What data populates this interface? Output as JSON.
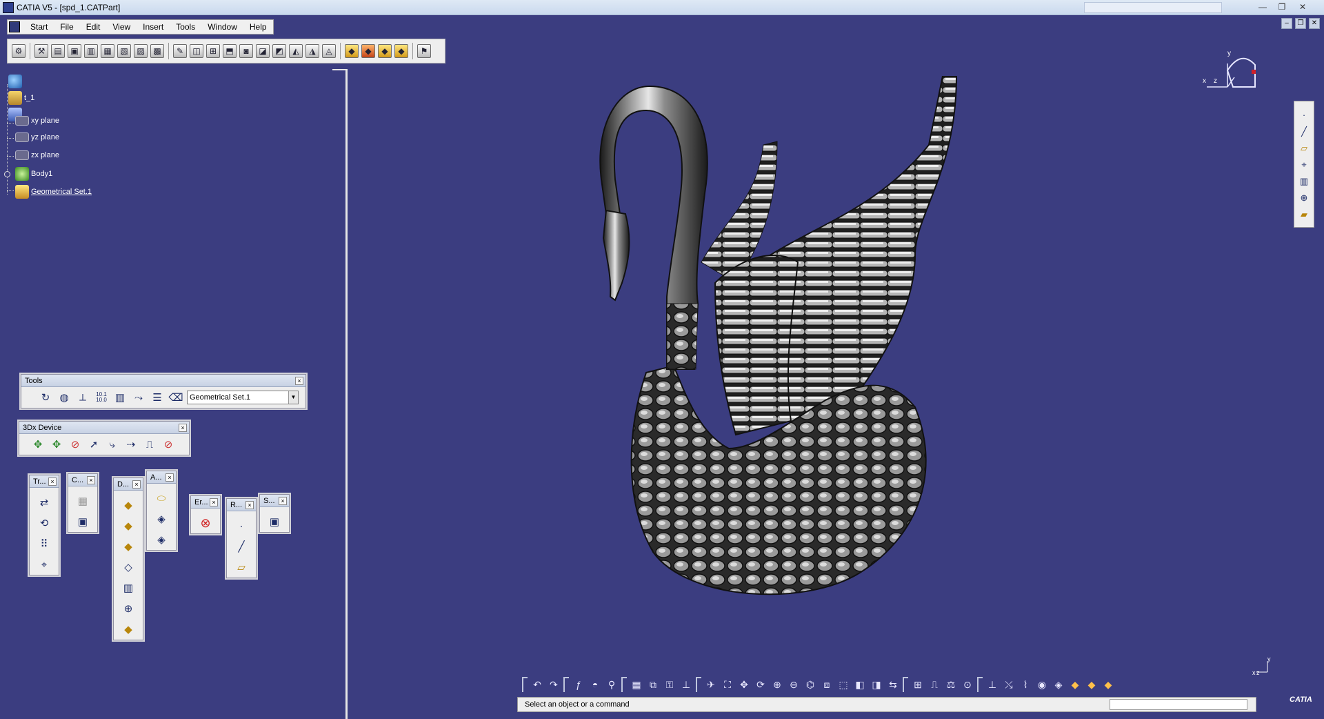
{
  "window": {
    "title": "CATIA V5 - [spd_1.CATPart]",
    "controls": [
      "—",
      "❐",
      "✕"
    ]
  },
  "menu": {
    "items": [
      "Start",
      "File",
      "Edit",
      "View",
      "Insert",
      "Tools",
      "Window",
      "Help"
    ]
  },
  "tree": {
    "root_label": "t_1",
    "nodes": [
      {
        "label": "xy plane",
        "underlined": false
      },
      {
        "label": "yz plane",
        "underlined": false
      },
      {
        "label": "zx plane",
        "underlined": false
      },
      {
        "label": "Body1",
        "underlined": false
      },
      {
        "label": "Geometrical Set.1",
        "underlined": true
      }
    ]
  },
  "palettes": {
    "tools": {
      "title": "Tools",
      "dropdown_value": "Geometrical Set.1",
      "scale_label": "10.1\n10.0"
    },
    "device": {
      "title": "3Dx Device"
    },
    "small": [
      {
        "title": "Tr..."
      },
      {
        "title": "C..."
      },
      {
        "title": "D..."
      },
      {
        "title": "A..."
      },
      {
        "title": "Er..."
      },
      {
        "title": "R..."
      },
      {
        "title": "S..."
      }
    ]
  },
  "compass": {
    "x": "x",
    "y": "y",
    "z": "z"
  },
  "mini_axis": {
    "x": "x",
    "y": "y",
    "z": "z"
  },
  "status": {
    "message": "Select an object or a command"
  },
  "brand": "CATIA",
  "colors": {
    "background": "#3b3d80",
    "panel": "#eeeeee",
    "model_light": "#d9d9d9",
    "model_dark": "#1e1e1e"
  }
}
